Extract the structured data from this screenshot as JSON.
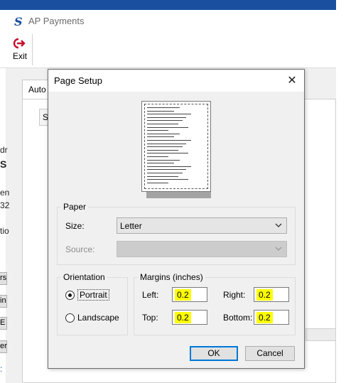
{
  "app": {
    "title": "AP Payments",
    "logo": "S",
    "exit_label": "Exit",
    "tab_auto": "Auto",
    "tab_s": "S",
    "fragments": [
      "dr",
      "S",
      "en",
      "32",
      "tio",
      "rs",
      "in",
      "E",
      "er",
      ":"
    ]
  },
  "dialog": {
    "title": "Page Setup",
    "close_icon": "close-icon",
    "preview_lines": 24,
    "paper": {
      "group_label": "Paper",
      "size_label": "Size:",
      "size_value": "Letter",
      "source_label": "Source:",
      "source_value": ""
    },
    "orientation": {
      "group_label": "Orientation",
      "options": [
        "Portrait",
        "Landscape"
      ],
      "selected": "Portrait"
    },
    "margins": {
      "group_label": "Margins (inches)",
      "left_label": "Left:",
      "left_value": "0.2",
      "right_label": "Right:",
      "right_value": "0.2",
      "top_label": "Top:",
      "top_value": "0.2",
      "bottom_label": "Bottom:",
      "bottom_value": "0.2"
    },
    "ok_label": "OK",
    "cancel_label": "Cancel"
  },
  "colors": {
    "brand": "#1a4fa0",
    "exit_icon": "#c8102e",
    "highlight": "#ffff00",
    "default_button_border": "#0078d7"
  }
}
